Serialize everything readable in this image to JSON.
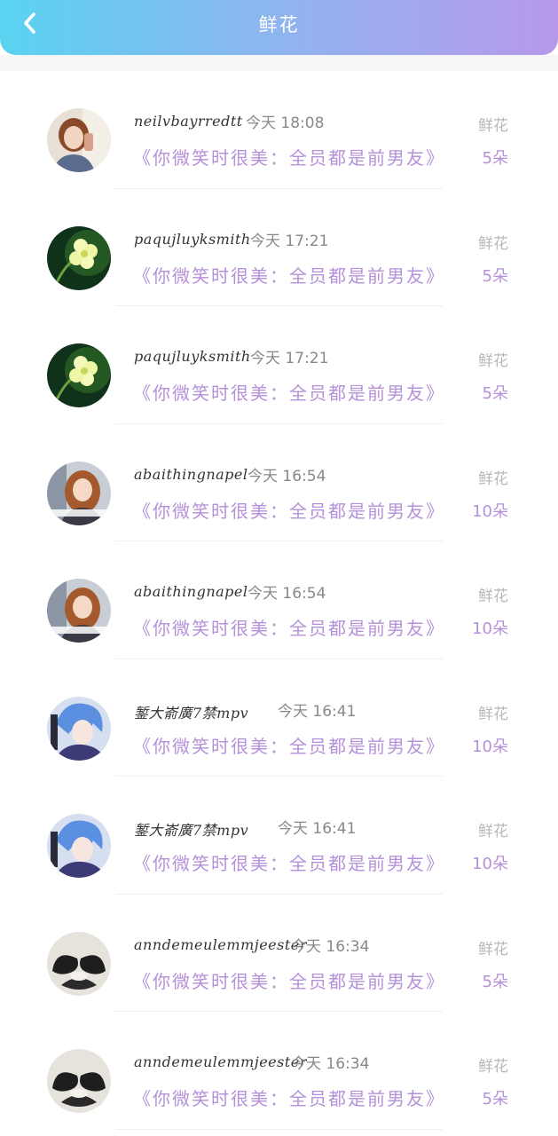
{
  "header": {
    "title": "鲜花",
    "back_icon": "chevron-left-icon",
    "gradient": [
      "#59d3f0",
      "#b799ea"
    ]
  },
  "colors": {
    "accent": "#b591d9",
    "muted": "#b8b8b8"
  },
  "items": [
    {
      "username": "neilvbayrredtt",
      "time": "今天 18:08",
      "work": "《你微笑时很美：全员都是前男友》",
      "gift_label": "鲜花",
      "gift_count": "5朵",
      "avatar": "avatar-girl-drink"
    },
    {
      "username": "paqujluyksmith",
      "time": "今天 17:21",
      "work": "《你微笑时很美：全员都是前男友》",
      "gift_label": "鲜花",
      "gift_count": "5朵",
      "avatar": "avatar-flower"
    },
    {
      "username": "paqujluyksmith",
      "time": "今天 17:21",
      "work": "《你微笑时很美：全员都是前男友》",
      "gift_label": "鲜花",
      "gift_count": "5朵",
      "avatar": "avatar-flower"
    },
    {
      "username": "abaithingnapel",
      "time": "今天 16:54",
      "work": "《你微笑时很美：全员都是前男友》",
      "gift_label": "鲜花",
      "gift_count": "10朵",
      "avatar": "avatar-girl-hair"
    },
    {
      "username": "abaithingnapel",
      "time": "今天 16:54",
      "work": "《你微笑时很美：全员都是前男友》",
      "gift_label": "鲜花",
      "gift_count": "10朵",
      "avatar": "avatar-girl-hair"
    },
    {
      "username": "錾大嵛廣7禁mpv",
      "time": "今天 16:41",
      "work": "《你微笑时很美：全员都是前男友》",
      "gift_label": "鲜花",
      "gift_count": "10朵",
      "avatar": "avatar-anime"
    },
    {
      "username": "錾大嵛廣7禁mpv",
      "time": "今天 16:41",
      "work": "《你微笑时很美：全员都是前男友》",
      "gift_label": "鲜花",
      "gift_count": "10朵",
      "avatar": "avatar-anime"
    },
    {
      "username": "anndemeulemmjeester",
      "time": "今天 16:34",
      "work": "《你微笑时很美：全员都是前男友》",
      "gift_label": "鲜花",
      "gift_count": "5朵",
      "avatar": "avatar-cats"
    },
    {
      "username": "anndemeulemmjeester",
      "time": "今天 16:34",
      "work": "《你微笑时很美：全员都是前男友》",
      "gift_label": "鲜花",
      "gift_count": "5朵",
      "avatar": "avatar-cats"
    }
  ]
}
